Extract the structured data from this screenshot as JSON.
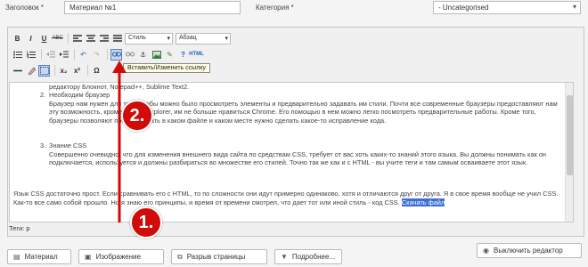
{
  "form": {
    "title_label": "Заголовок *",
    "title_value": "Материал №1",
    "category_label": "Категория *",
    "category_value": "- Uncategorised"
  },
  "toolbar": {
    "row1": {
      "bold": "B",
      "italic": "I",
      "underline": "U",
      "strike": "ABC",
      "style_select": "Стиль",
      "format_select": "Абзац"
    },
    "row3": {
      "sub": "x₂",
      "sup": "x²",
      "omega": "Ω"
    },
    "tooltip": "Вставить/Изменить ссылку"
  },
  "content": {
    "items": [
      {
        "text": "редактору Блокнот, Notepad++, Sublime Text2."
      },
      {
        "heading": "Необходим браузер",
        "text": "Браузер нам нужен для того, чтобы можно было просмотреть элементы и предварительно задавать им стили. Почти все современные браузеры предоставляют нам эту возможность, кроме InternetExplorer, им не больше нравиться Chrome. Его помощью в нем можно легко посмотреть предварительные работы. Кроме того, браузеры позволяют просмотривать в каком файле и каком месте нужно сделать какое-то исправление кода."
      },
      {
        "heading": "Знание CSS",
        "text": "Совершенно очевидно, что для изменения внешнего вида сайта по средствам CSS, требует от вас хоть каких-то знаний этого языка. Вы должны понимать как он подключается, используется и должны разбираться во множестве его стилей. Точно так же как и с HTML - вы учите теги и там самым осваиваете этот язык."
      }
    ],
    "paragraph": "Язык CSS достаточно прост. Если сравнивать его с HTML, то по сложности они идут примерно одинаково, хотя и отличаются друг от друга. Я в свое время вообще не учил CSS. Как-то все само собой прошло. Но я знаю его принципы, и время от времени смотрел, что дает тот или иной стиль - код CSS.",
    "selected_text": "Скачать файл"
  },
  "status": {
    "path": "Теги: p"
  },
  "buttons": {
    "article": "Материал",
    "image": "Изображение",
    "pagebreak": "Разрыв страницы",
    "readmore": "Подробнее...",
    "toggle_editor": "Выключить редактор"
  },
  "annotations": {
    "step1": "1.",
    "step2": "2."
  },
  "colors": {
    "annotation_red": "#d10a0a",
    "selection_blue": "#3b6fd3"
  },
  "icons": [
    "bold-icon",
    "italic-icon",
    "underline-icon",
    "strikethrough-icon",
    "align-left-icon",
    "align-center-icon",
    "align-right-icon",
    "align-justify-icon",
    "bullet-list-icon",
    "numbered-list-icon",
    "outdent-icon",
    "indent-icon",
    "undo-icon",
    "redo-icon",
    "link-icon",
    "unlink-icon",
    "anchor-icon",
    "image-icon",
    "cleanup-icon",
    "help-icon",
    "html-icon",
    "horizontal-rule-icon",
    "eraser-icon",
    "visual-aid-icon",
    "subscript-icon",
    "superscript-icon",
    "special-char-icon"
  ]
}
